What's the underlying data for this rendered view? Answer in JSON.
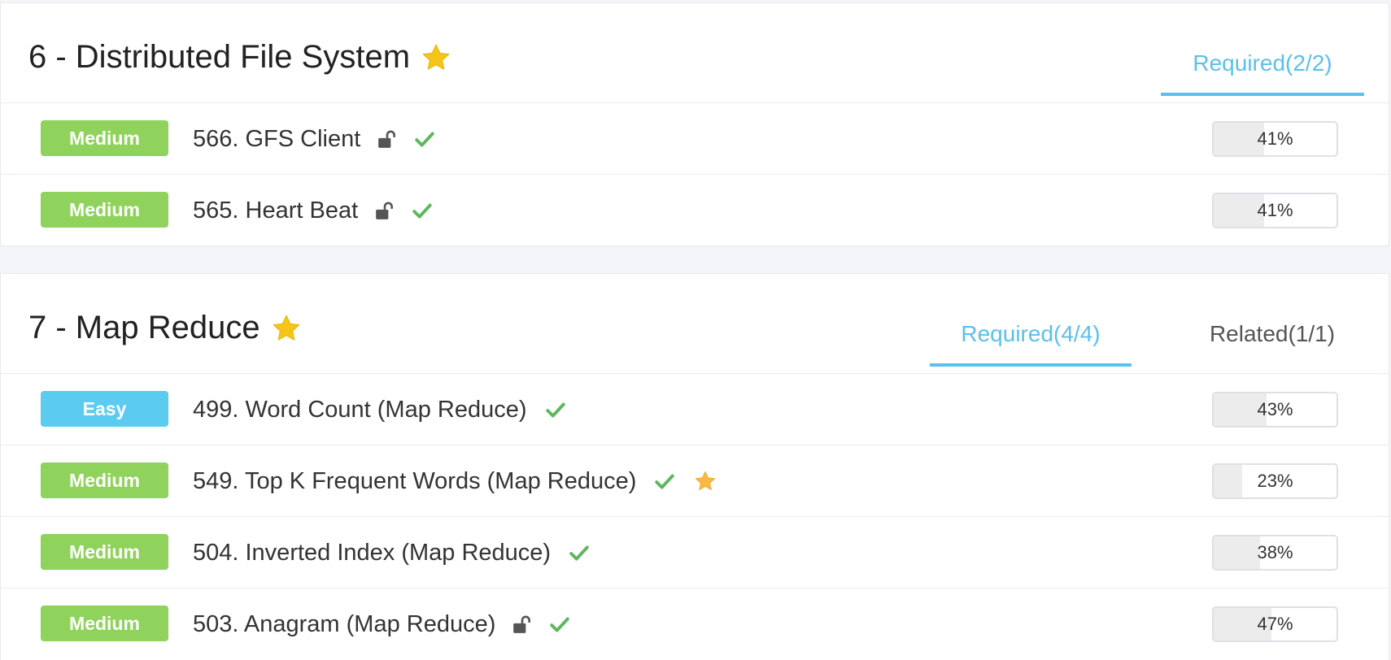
{
  "colors": {
    "accent": "#5bc0eb",
    "medium": "#8fd25c",
    "easy": "#5bcbf0",
    "check": "#5cb85c",
    "star": "#f5c518"
  },
  "sections": [
    {
      "title": "6 - Distributed File System",
      "starred": true,
      "tabs": [
        {
          "label": "Required(2/2)",
          "active": true
        }
      ],
      "problems": [
        {
          "difficulty": "Medium",
          "title": "566. GFS Client",
          "locked_icon": "unlock-icon",
          "solved": true,
          "starred": false,
          "acceptance": "41%",
          "acceptance_value": 41
        },
        {
          "difficulty": "Medium",
          "title": "565. Heart Beat",
          "locked_icon": "unlock-icon",
          "solved": true,
          "starred": false,
          "acceptance": "41%",
          "acceptance_value": 41
        }
      ]
    },
    {
      "title": "7 - Map Reduce",
      "starred": true,
      "tabs": [
        {
          "label": "Required(4/4)",
          "active": true
        },
        {
          "label": "Related(1/1)",
          "active": false
        }
      ],
      "problems": [
        {
          "difficulty": "Easy",
          "title": "499. Word Count (Map Reduce)",
          "locked_icon": null,
          "solved": true,
          "starred": false,
          "acceptance": "43%",
          "acceptance_value": 43
        },
        {
          "difficulty": "Medium",
          "title": "549. Top K Frequent Words (Map Reduce)",
          "locked_icon": null,
          "solved": true,
          "starred": true,
          "acceptance": "23%",
          "acceptance_value": 23
        },
        {
          "difficulty": "Medium",
          "title": "504. Inverted Index (Map Reduce)",
          "locked_icon": null,
          "solved": true,
          "starred": false,
          "acceptance": "38%",
          "acceptance_value": 38
        },
        {
          "difficulty": "Medium",
          "title": "503. Anagram (Map Reduce)",
          "locked_icon": "unlock-icon",
          "solved": true,
          "starred": false,
          "acceptance": "47%",
          "acceptance_value": 47
        }
      ]
    }
  ]
}
